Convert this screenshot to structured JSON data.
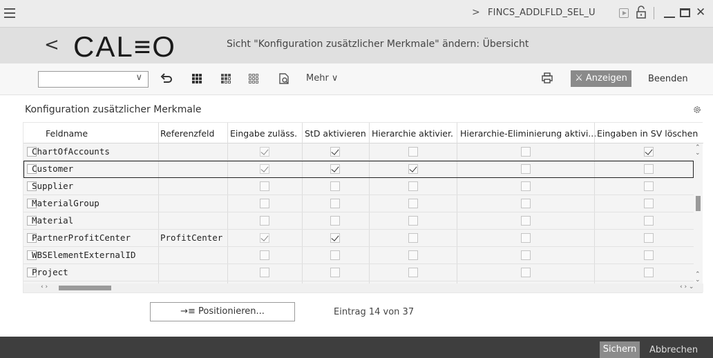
{
  "titlebar": {
    "chevron": ">",
    "transaction": "FINCS_ADDLFLD_SEL_U",
    "icons": [
      "hamburger-icon",
      "play-icon",
      "unlock-icon",
      "minimize-icon",
      "maximize-icon",
      "close-icon"
    ]
  },
  "header": {
    "back": "<",
    "logo": "CAL≡O",
    "title": "Sicht \"Konfiguration zusätzlicher Merkmale\" ändern: Übersicht"
  },
  "toolbar": {
    "dropdown_value": "",
    "dropdown_chevron": "∨",
    "mehr": "Mehr ∨",
    "anzeigen": "⚔ Anzeigen",
    "beenden": "Beenden"
  },
  "table": {
    "title": "Konfiguration zusätzlicher Merkmale",
    "headers": [
      "Feldname",
      "Referenzfeld",
      "Eingabe zuläss.",
      "StD aktivieren",
      "Hierarchie aktivier.",
      "Hierarchie-Eliminierung aktivi...",
      "Eingaben in SV löschen"
    ],
    "rows": [
      {
        "feld": "ChartOfAccounts",
        "ref": "",
        "eingabe": true,
        "std": true,
        "hier": false,
        "elim": false,
        "sv": true,
        "selected": false
      },
      {
        "feld": "Customer",
        "ref": "",
        "eingabe": true,
        "std": true,
        "hier": true,
        "elim": false,
        "sv": false,
        "selected": true
      },
      {
        "feld": "Supplier",
        "ref": "",
        "eingabe": false,
        "std": false,
        "hier": false,
        "elim": false,
        "sv": false,
        "selected": false
      },
      {
        "feld": "MaterialGroup",
        "ref": "",
        "eingabe": false,
        "std": false,
        "hier": false,
        "elim": false,
        "sv": false,
        "selected": false
      },
      {
        "feld": "Material",
        "ref": "",
        "eingabe": false,
        "std": false,
        "hier": false,
        "elim": false,
        "sv": false,
        "selected": false
      },
      {
        "feld": "PartnerProfitCenter",
        "ref": "ProfitCenter",
        "eingabe": true,
        "std": true,
        "hier": false,
        "elim": false,
        "sv": false,
        "selected": false
      },
      {
        "feld": "WBSElementExternalID",
        "ref": "",
        "eingabe": false,
        "std": false,
        "hier": false,
        "elim": false,
        "sv": false,
        "selected": false
      },
      {
        "feld": "Project",
        "ref": "",
        "eingabe": false,
        "std": false,
        "hier": false,
        "elim": false,
        "sv": false,
        "selected": false
      }
    ],
    "scroll_position_fraction": 0.38
  },
  "positionieren": "→≡ Positionieren...",
  "eintrag": "Eintrag 14 von 37",
  "footer": {
    "sichern": "Sichern",
    "abbrechen": "Abbrechen"
  }
}
